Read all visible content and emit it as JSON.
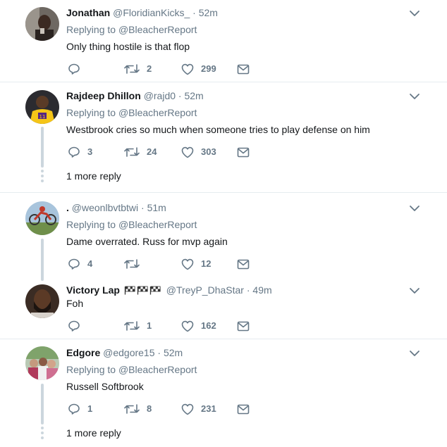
{
  "replies": [
    {
      "name": "Jonathan",
      "handle": "@FloridianKicks_",
      "time": "52m",
      "replying_label": "Replying to",
      "replying_to": "@BleacherReport",
      "text": "Only thing hostile is that flop",
      "reply_count": "",
      "retweet_count": "2",
      "like_count": "299"
    },
    {
      "name": "Rajdeep Dhillon",
      "handle": "@rajd0",
      "time": "52m",
      "replying_label": "Replying to",
      "replying_to": "@BleacherReport",
      "text": "Westbrook cries so much when someone tries to play defense on him",
      "reply_count": "3",
      "retweet_count": "24",
      "like_count": "303",
      "more_replies": "1 more reply"
    },
    {
      "name": ".",
      "handle": "@weonlbvtbtwi",
      "time": "51m",
      "replying_label": "Replying to",
      "replying_to": "@BleacherReport",
      "text": "Dame overrated. Russ for mvp again",
      "reply_count": "4",
      "retweet_count": "",
      "like_count": "12"
    },
    {
      "name": "Victory Lap",
      "handle": "@TreyP_DhaStar",
      "time": "49m",
      "text": "Foh",
      "reply_count": "",
      "retweet_count": "1",
      "like_count": "162"
    },
    {
      "name": "Edgore",
      "handle": "@edgore15",
      "time": "52m",
      "replying_label": "Replying to",
      "replying_to": "@BleacherReport",
      "text": "Russell Softbrook",
      "reply_count": "1",
      "retweet_count": "8",
      "like_count": "231",
      "more_replies": "1 more reply"
    }
  ],
  "separator": "·",
  "icons": [
    "reply-icon",
    "retweet-icon",
    "like-icon",
    "message-icon",
    "chevron-down-icon",
    "checkered-flag-icon"
  ],
  "colors": {
    "text": "#14171a",
    "secondary": "#657786",
    "thread_line": "#ccd6dd",
    "divider": "#e6ecf0"
  }
}
